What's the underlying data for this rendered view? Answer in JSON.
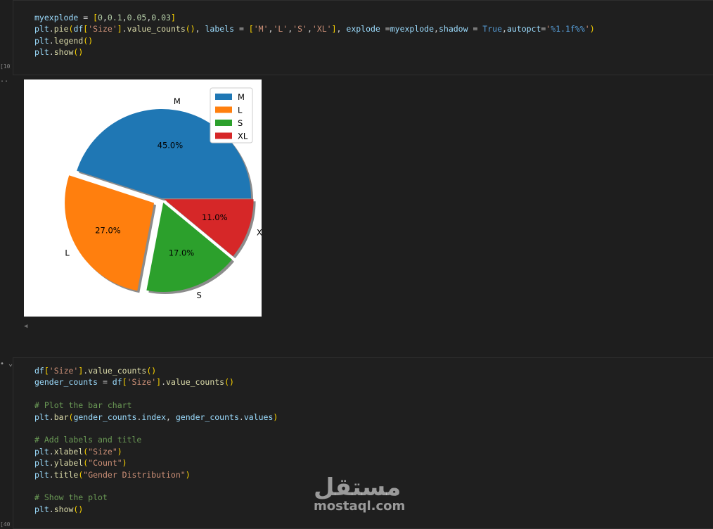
{
  "cells": {
    "pie_cell": {
      "exec_count": "[10]",
      "code": [
        [
          {
            "t": "myexplode",
            "c": "var"
          },
          {
            "t": " = ",
            "c": "op"
          },
          {
            "t": "[",
            "c": "br"
          },
          {
            "t": "0",
            "c": "num"
          },
          {
            "t": ",",
            "c": "op"
          },
          {
            "t": "0.1",
            "c": "num"
          },
          {
            "t": ",",
            "c": "op"
          },
          {
            "t": "0.05",
            "c": "num"
          },
          {
            "t": ",",
            "c": "op"
          },
          {
            "t": "0.03",
            "c": "num"
          },
          {
            "t": "]",
            "c": "br"
          }
        ],
        [
          {
            "t": "plt",
            "c": "var"
          },
          {
            "t": ".",
            "c": "op"
          },
          {
            "t": "pie",
            "c": "fn"
          },
          {
            "t": "(",
            "c": "br"
          },
          {
            "t": "df",
            "c": "var"
          },
          {
            "t": "[",
            "c": "br"
          },
          {
            "t": "'Size'",
            "c": "str"
          },
          {
            "t": "]",
            "c": "br"
          },
          {
            "t": ".",
            "c": "op"
          },
          {
            "t": "value_counts",
            "c": "fn"
          },
          {
            "t": "()",
            "c": "br"
          },
          {
            "t": ", ",
            "c": "op"
          },
          {
            "t": "labels",
            "c": "var"
          },
          {
            "t": " = ",
            "c": "op"
          },
          {
            "t": "[",
            "c": "br"
          },
          {
            "t": "'M'",
            "c": "str"
          },
          {
            "t": ",",
            "c": "op"
          },
          {
            "t": "'L'",
            "c": "str"
          },
          {
            "t": ",",
            "c": "op"
          },
          {
            "t": "'S'",
            "c": "str"
          },
          {
            "t": ",",
            "c": "op"
          },
          {
            "t": "'XL'",
            "c": "str"
          },
          {
            "t": "]",
            "c": "br"
          },
          {
            "t": ", ",
            "c": "op"
          },
          {
            "t": "explode",
            "c": "var"
          },
          {
            "t": " =",
            "c": "op"
          },
          {
            "t": "myexplode",
            "c": "var"
          },
          {
            "t": ",",
            "c": "op"
          },
          {
            "t": "shadow",
            "c": "var"
          },
          {
            "t": " = ",
            "c": "op"
          },
          {
            "t": "True",
            "c": "kw"
          },
          {
            "t": ",",
            "c": "op"
          },
          {
            "t": "autopct",
            "c": "var"
          },
          {
            "t": "=",
            "c": "op"
          },
          {
            "t": "'",
            "c": "str"
          },
          {
            "t": "%1.1f%%",
            "c": "kw"
          },
          {
            "t": "'",
            "c": "str"
          },
          {
            "t": ")",
            "c": "br"
          }
        ],
        [
          {
            "t": "plt",
            "c": "var"
          },
          {
            "t": ".",
            "c": "op"
          },
          {
            "t": "legend",
            "c": "fn"
          },
          {
            "t": "()",
            "c": "br"
          }
        ],
        [
          {
            "t": "plt",
            "c": "var"
          },
          {
            "t": ".",
            "c": "op"
          },
          {
            "t": "show",
            "c": "fn"
          },
          {
            "t": "()",
            "c": "br"
          }
        ]
      ]
    },
    "output_marker": "..",
    "bar_cell": {
      "exec_count": "[40]",
      "collapse_marker": "• ⌄",
      "code": [
        [
          {
            "t": "df",
            "c": "var"
          },
          {
            "t": "[",
            "c": "br"
          },
          {
            "t": "'Size'",
            "c": "str"
          },
          {
            "t": "]",
            "c": "br"
          },
          {
            "t": ".",
            "c": "op"
          },
          {
            "t": "value_counts",
            "c": "fn"
          },
          {
            "t": "()",
            "c": "br"
          }
        ],
        [
          {
            "t": "gender_counts",
            "c": "var"
          },
          {
            "t": " = ",
            "c": "op"
          },
          {
            "t": "df",
            "c": "var"
          },
          {
            "t": "[",
            "c": "br"
          },
          {
            "t": "'Size'",
            "c": "str"
          },
          {
            "t": "]",
            "c": "br"
          },
          {
            "t": ".",
            "c": "op"
          },
          {
            "t": "value_counts",
            "c": "fn"
          },
          {
            "t": "()",
            "c": "br"
          }
        ],
        [],
        [
          {
            "t": "# Plot the bar chart",
            "c": "com"
          }
        ],
        [
          {
            "t": "plt",
            "c": "var"
          },
          {
            "t": ".",
            "c": "op"
          },
          {
            "t": "bar",
            "c": "fn"
          },
          {
            "t": "(",
            "c": "br"
          },
          {
            "t": "gender_counts",
            "c": "var"
          },
          {
            "t": ".",
            "c": "op"
          },
          {
            "t": "index",
            "c": "var"
          },
          {
            "t": ", ",
            "c": "op"
          },
          {
            "t": "gender_counts",
            "c": "var"
          },
          {
            "t": ".",
            "c": "op"
          },
          {
            "t": "values",
            "c": "var"
          },
          {
            "t": ")",
            "c": "br"
          }
        ],
        [],
        [
          {
            "t": "# Add labels and title",
            "c": "com"
          }
        ],
        [
          {
            "t": "plt",
            "c": "var"
          },
          {
            "t": ".",
            "c": "op"
          },
          {
            "t": "xlabel",
            "c": "fn"
          },
          {
            "t": "(",
            "c": "br"
          },
          {
            "t": "\"Size\"",
            "c": "str"
          },
          {
            "t": ")",
            "c": "br"
          }
        ],
        [
          {
            "t": "plt",
            "c": "var"
          },
          {
            "t": ".",
            "c": "op"
          },
          {
            "t": "ylabel",
            "c": "fn"
          },
          {
            "t": "(",
            "c": "br"
          },
          {
            "t": "\"Count\"",
            "c": "str"
          },
          {
            "t": ")",
            "c": "br"
          }
        ],
        [
          {
            "t": "plt",
            "c": "var"
          },
          {
            "t": ".",
            "c": "op"
          },
          {
            "t": "title",
            "c": "fn"
          },
          {
            "t": "(",
            "c": "br"
          },
          {
            "t": "\"Gender Distribution\"",
            "c": "str"
          },
          {
            "t": ")",
            "c": "br"
          }
        ],
        [],
        [
          {
            "t": "# Show the plot",
            "c": "com"
          }
        ],
        [
          {
            "t": "plt",
            "c": "var"
          },
          {
            "t": ".",
            "c": "op"
          },
          {
            "t": "show",
            "c": "fn"
          },
          {
            "t": "()",
            "c": "br"
          }
        ]
      ]
    }
  },
  "output_scroll_icon": "◀",
  "watermark": {
    "arabic": "مستقل",
    "latin": "mostaql.com"
  },
  "chart_data": {
    "type": "pie",
    "labels": [
      "M",
      "L",
      "S",
      "XL"
    ],
    "values": [
      45.0,
      27.0,
      17.0,
      11.0
    ],
    "pct_labels": [
      "45.0%",
      "27.0%",
      "17.0%",
      "11.0%"
    ],
    "explode": [
      0,
      0.1,
      0.05,
      0.03
    ],
    "colors": [
      "#1f77b4",
      "#ff7f0e",
      "#2ca02c",
      "#d62728"
    ],
    "shadow": true,
    "legend": {
      "position": "top-right",
      "entries": [
        "M",
        "L",
        "S",
        "XL"
      ]
    }
  }
}
